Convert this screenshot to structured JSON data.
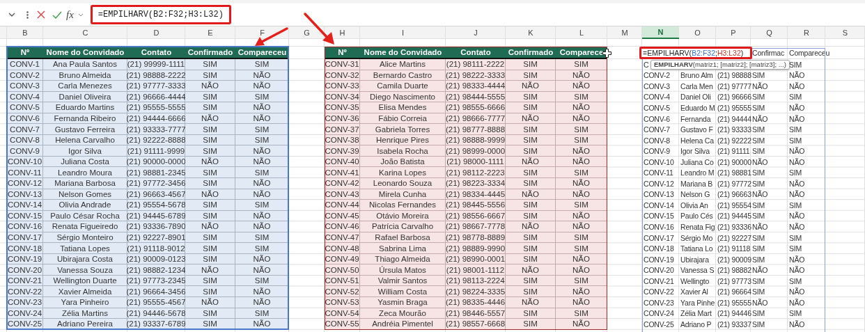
{
  "formula_bar": {
    "function_label": "fx",
    "formula": "=EMPILHARV(B2:F32;H3:L32)"
  },
  "column_letters": [
    {
      "label": "B",
      "selected": false
    },
    {
      "label": "C",
      "selected": false
    },
    {
      "label": "D",
      "selected": false
    },
    {
      "label": "E",
      "selected": false
    },
    {
      "label": "F",
      "selected": false
    },
    {
      "label": "G",
      "selected": false
    },
    {
      "label": "H",
      "selected": false
    },
    {
      "label": "I",
      "selected": false
    },
    {
      "label": "J",
      "selected": false
    },
    {
      "label": "K",
      "selected": false
    },
    {
      "label": "L",
      "selected": false
    },
    {
      "label": "M",
      "selected": false
    },
    {
      "label": "N",
      "selected": true
    },
    {
      "label": "O",
      "selected": false
    },
    {
      "label": "P",
      "selected": false
    },
    {
      "label": "Q",
      "selected": false
    },
    {
      "label": "R",
      "selected": false
    },
    {
      "label": "S",
      "selected": false
    }
  ],
  "tables": [
    {
      "columns": [
        "Nº",
        "Nome do Convidado",
        "Contato",
        "Confirmado",
        "Compareceu"
      ],
      "rows": [
        [
          "CONV-1",
          "Ana Paula Santos",
          "(21) 99999-1111",
          "SIM",
          "SIM"
        ],
        [
          "CONV-2",
          "Bruno Almeida",
          "(21) 98888-2222",
          "SIM",
          "NÃO"
        ],
        [
          "CONV-3",
          "Carla Menezes",
          "(21) 97777-3333",
          "NÃO",
          "NÃO"
        ],
        [
          "CONV-4",
          "Daniel Oliveira",
          "(21) 96666-4444",
          "SIM",
          "SIM"
        ],
        [
          "CONV-5",
          "Eduardo Martins",
          "(21) 95555-5555",
          "SIM",
          "NÃO"
        ],
        [
          "CONV-6",
          "Fernanda Ribeiro",
          "(21) 94444-6666",
          "NÃO",
          "NÃO"
        ],
        [
          "CONV-7",
          "Gustavo Ferreira",
          "(21) 93333-7777",
          "SIM",
          "SIM"
        ],
        [
          "CONV-8",
          "Helena Carvalho",
          "(21) 92222-8888",
          "SIM",
          "SIM"
        ],
        [
          "CONV-9",
          "Igor Silva",
          "(21) 91111-9999",
          "SIM",
          "NÃO"
        ],
        [
          "CONV-10",
          "Juliana Costa",
          "(21) 90000-0000",
          "NÃO",
          "NÃO"
        ],
        [
          "CONV-11",
          "Leandro Moura",
          "(21) 98881-2345",
          "SIM",
          "SIM"
        ],
        [
          "CONV-12",
          "Mariana Barbosa",
          "(21) 97772-3456",
          "SIM",
          "NÃO"
        ],
        [
          "CONV-13",
          "Nelson Gomes",
          "(21) 96663-4567",
          "NÃO",
          "NÃO"
        ],
        [
          "CONV-14",
          "Olivia Andrade",
          "(21) 95554-5678",
          "SIM",
          "SIM"
        ],
        [
          "CONV-15",
          "Paulo César Rocha",
          "(21) 94445-6789",
          "SIM",
          "NÃO"
        ],
        [
          "CONV-16",
          "Renata Figueiredo",
          "(21) 93336-7890",
          "NÃO",
          "NÃO"
        ],
        [
          "CONV-17",
          "Sérgio Monteiro",
          "(21) 92227-8901",
          "SIM",
          "SIM"
        ],
        [
          "CONV-18",
          "Tatiana Lopes",
          "(21) 91118-9012",
          "SIM",
          "SIM"
        ],
        [
          "CONV-19",
          "Ubirajara Costa",
          "(21) 90009-0123",
          "SIM",
          "NÃO"
        ],
        [
          "CONV-20",
          "Vanessa Souza",
          "(21) 98882-1234",
          "NÃO",
          "NÃO"
        ],
        [
          "CONV-21",
          "Wellington Duarte",
          "(21) 97773-2345",
          "SIM",
          "SIM"
        ],
        [
          "CONV-22",
          "Xavier Almeida",
          "(21) 96664-3456",
          "SIM",
          "NÃO"
        ],
        [
          "CONV-23",
          "Yara Pinheiro",
          "(21) 95555-4567",
          "NÃO",
          "NÃO"
        ],
        [
          "CONV-24",
          "Zélia Martins",
          "(21) 94446-5678",
          "SIM",
          "SIM"
        ],
        [
          "CONV-25",
          "Adriano Pereira",
          "(21) 93337-6789",
          "SIM",
          "NÃO"
        ]
      ]
    },
    {
      "columns": [
        "Nº",
        "Nome do Convidado",
        "Contato",
        "Confirmado",
        "Comparece"
      ],
      "rows": [
        [
          "CONV-31",
          "Alice Martins",
          "(21) 98111-2222",
          "SIM",
          "SIM"
        ],
        [
          "CONV-32",
          "Bernardo Castro",
          "(21) 98222-3333",
          "SIM",
          "NÃO"
        ],
        [
          "CONV-33",
          "Camila Duarte",
          "(21) 98333-4444",
          "NÃO",
          "NÃO"
        ],
        [
          "CONV-34",
          "Diego Nascimento",
          "(21) 98444-5555",
          "SIM",
          "SIM"
        ],
        [
          "CONV-35",
          "Elisa Mendes",
          "(21) 98555-6666",
          "SIM",
          "NÃO"
        ],
        [
          "CONV-36",
          "Fábio Correia",
          "(21) 98666-7777",
          "NÃO",
          "NÃO"
        ],
        [
          "CONV-37",
          "Gabriela Torres",
          "(21) 98777-8888",
          "SIM",
          "SIM"
        ],
        [
          "CONV-38",
          "Henrique Pires",
          "(21) 98888-9999",
          "SIM",
          "SIM"
        ],
        [
          "CONV-39",
          "Isabela Rocha",
          "(21) 98999-0000",
          "SIM",
          "NÃO"
        ],
        [
          "CONV-40",
          "João Batista",
          "(21) 98000-1111",
          "NÃO",
          "NÃO"
        ],
        [
          "CONV-41",
          "Karina Lopes",
          "(21) 98112-2223",
          "SIM",
          "SIM"
        ],
        [
          "CONV-42",
          "Leonardo Souza",
          "(21) 98223-3334",
          "SIM",
          "NÃO"
        ],
        [
          "CONV-43",
          "Mirela Cunha",
          "(21) 98334-4445",
          "NÃO",
          "NÃO"
        ],
        [
          "CONV-44",
          "Nicolas Fernandes",
          "(21) 98445-5556",
          "SIM",
          "SIM"
        ],
        [
          "CONV-45",
          "Otávio Moreira",
          "(21) 98556-6667",
          "SIM",
          "NÃO"
        ],
        [
          "CONV-46",
          "Patrícia Carvalho",
          "(21) 98667-7778",
          "NÃO",
          "NÃO"
        ],
        [
          "CONV-47",
          "Rafael Barbosa",
          "(21) 98778-8889",
          "SIM",
          "SIM"
        ],
        [
          "CONV-48",
          "Sabrina Lima",
          "(21) 98889-9990",
          "SIM",
          "SIM"
        ],
        [
          "CONV-49",
          "Thiago Almeida",
          "(21) 98990-0001",
          "SIM",
          "NÃO"
        ],
        [
          "CONV-50",
          "Úrsula Matos",
          "(21) 98001-1112",
          "NÃO",
          "NÃO"
        ],
        [
          "CONV-51",
          "Valmir Santos",
          "(21) 98113-2224",
          "SIM",
          "SIM"
        ],
        [
          "CONV-52",
          "William Costa",
          "(21) 98224-3335",
          "SIM",
          "NÃO"
        ],
        [
          "CONV-53",
          "Yasmin Braga",
          "(21) 98335-4446",
          "NÃO",
          "NÃO"
        ],
        [
          "CONV-54",
          "Zeca Mourão",
          "(21) 98446-5557",
          "SIM",
          "SIM"
        ],
        [
          "CONV-55",
          "Andréia Pimentel",
          "(21) 98557-6668",
          "SIM",
          "NÃO"
        ]
      ]
    }
  ],
  "spill": {
    "formula_parts": [
      {
        "text": "=EMPILHARV("
      },
      {
        "text": "B2:F32",
        "color": "#3c6fc8"
      },
      {
        "text": ";"
      },
      {
        "text": "H3:L32",
        "color": "#c0392b"
      },
      {
        "text": ")"
      }
    ],
    "headers": [
      "Confirmac",
      "Compareceu"
    ],
    "first_row": [
      "C",
      "SIM"
    ],
    "tooltip": "**EMPILHARV**(matriz1; [matriz2]; [matriz3]; ...)",
    "rows": [
      [
        "CONV-2",
        "Bruno Alm",
        "(21) 98888",
        "SIM",
        "NÃO"
      ],
      [
        "CONV-3",
        "Carla Men",
        "(21) 97777",
        "NÃO",
        "NÃO"
      ],
      [
        "CONV-4",
        "Daniel Oli",
        "(21) 96666",
        "SIM",
        "SIM"
      ],
      [
        "CONV-5",
        "Eduardo M",
        "(21) 95555",
        "SIM",
        "NÃO"
      ],
      [
        "CONV-6",
        "Fernanda",
        "(21) 94444",
        "NÃO",
        "NÃO"
      ],
      [
        "CONV-7",
        "Gustavo F",
        "(21) 93333",
        "SIM",
        "SIM"
      ],
      [
        "CONV-8",
        "Helena Ca",
        "(21) 92222",
        "SIM",
        "SIM"
      ],
      [
        "CONV-9",
        "Igor Silva",
        "(21) 91111",
        "SIM",
        "NÃO"
      ],
      [
        "CONV-10",
        "Juliana Co",
        "(21) 90000",
        "NÃO",
        "NÃO"
      ],
      [
        "CONV-11",
        "Leandro M",
        "(21) 98881",
        "SIM",
        "SIM"
      ],
      [
        "CONV-12",
        "Mariana B",
        "(21) 97772",
        "SIM",
        "NÃO"
      ],
      [
        "CONV-13",
        "Nelson G",
        "(21) 96663",
        "NÃO",
        "NÃO"
      ],
      [
        "CONV-14",
        "Olivia An",
        "(21) 95554",
        "SIM",
        "SIM"
      ],
      [
        "CONV-15",
        "Paulo Cés",
        "(21) 94445",
        "SIM",
        "NÃO"
      ],
      [
        "CONV-16",
        "Renata Fig",
        "(21) 93336",
        "NÃO",
        "NÃO"
      ],
      [
        "CONV-17",
        "Sérgio Mo",
        "(21) 92227",
        "SIM",
        "SIM"
      ],
      [
        "CONV-18",
        "Tatiana Lo",
        "(21) 91118",
        "SIM",
        "SIM"
      ],
      [
        "CONV-19",
        "Ubirajara",
        "(21) 90009",
        "SIM",
        "NÃO"
      ],
      [
        "CONV-20",
        "Vanessa S",
        "(21) 98882",
        "NÃO",
        "NÃO"
      ],
      [
        "CONV-21",
        "Wellingto",
        "(21) 97773",
        "SIM",
        "SIM"
      ],
      [
        "CONV-22",
        "Xavier Al",
        "(21) 96664",
        "SIM",
        "NÃO"
      ],
      [
        "CONV-23",
        "Yara Pinhe",
        "(21) 95555",
        "NÃO",
        "NÃO"
      ],
      [
        "CONV-24",
        "Zélia Mart",
        "(21) 94446",
        "SIM",
        "SIM"
      ],
      [
        "CONV-25",
        "Adriano P",
        "(21) 93337",
        "SIM",
        "NÃO"
      ]
    ]
  }
}
